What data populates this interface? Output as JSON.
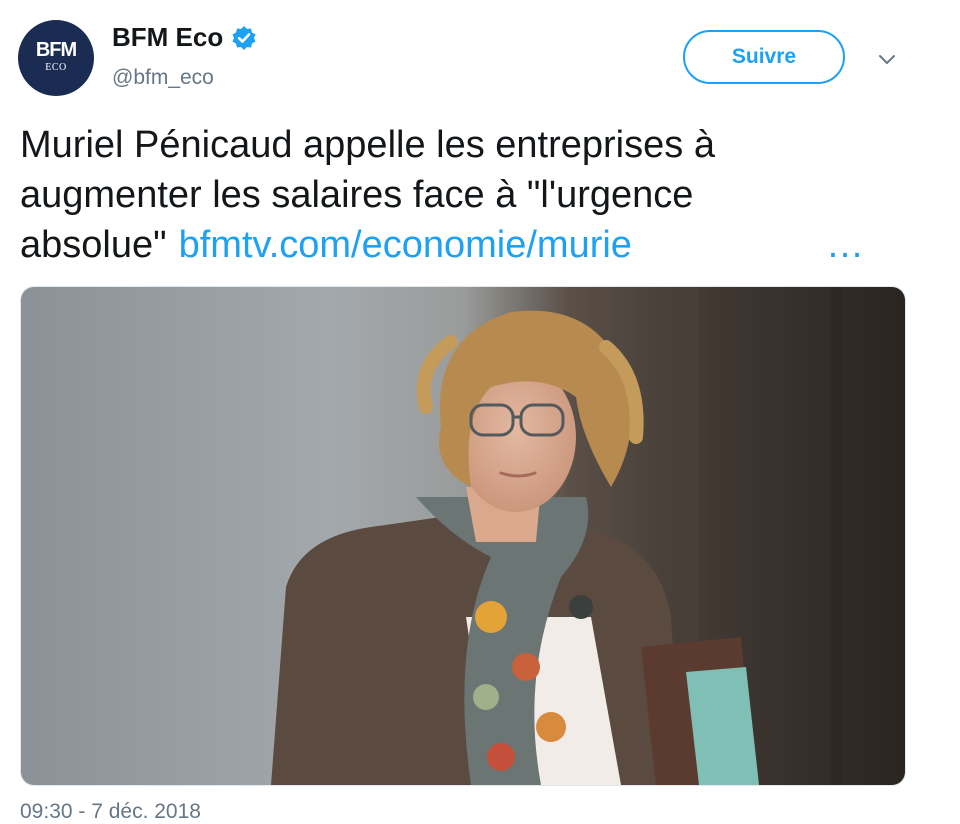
{
  "account": {
    "display_name": "BFM Eco",
    "handle": "@bfm_eco",
    "avatar_logo_main": "BFM",
    "avatar_logo_sub": "ECO",
    "verified_icon": "verified-badge-icon"
  },
  "actions": {
    "follow_label": "Suivre",
    "more_icon": "chevron-down-icon"
  },
  "tweet": {
    "text": "Muriel Pénicaud appelle les entreprises à augmenter les salaires face à \"l'urgence absolue\"",
    "link": "bfmtv.com/economie/murie",
    "ellipsis": "…",
    "timestamp": "09:30 - 7 déc. 2018"
  },
  "colors": {
    "accent": "#1da1f2",
    "avatar_bg": "#1b2c52",
    "secondary_text": "#657786"
  }
}
